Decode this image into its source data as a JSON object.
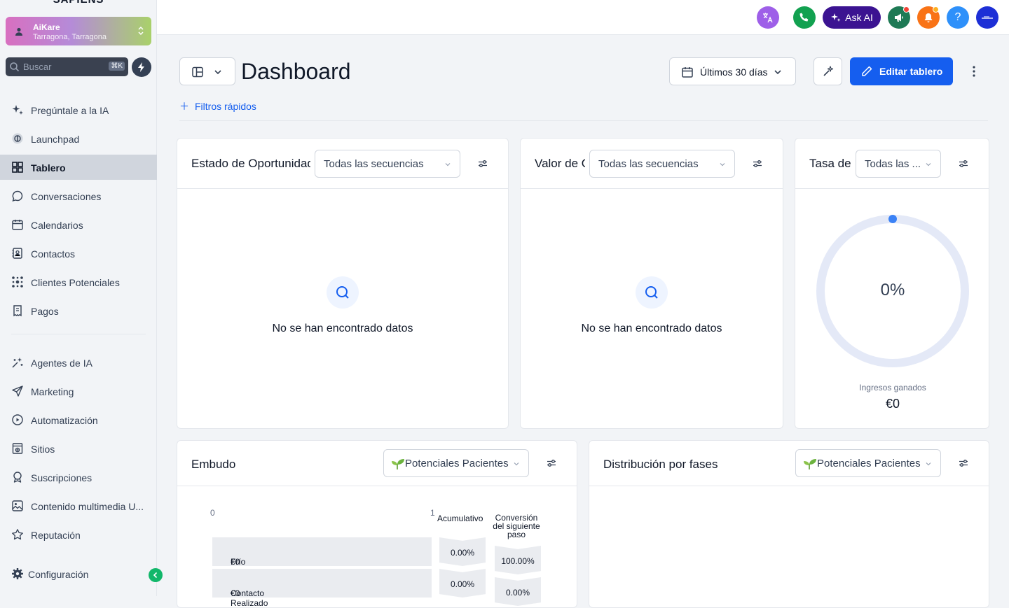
{
  "brand": "SAPIENS",
  "location": {
    "name": "AiKare",
    "address": "Tarragona, Tarragona"
  },
  "search": {
    "placeholder": "Buscar",
    "shortcut": "⌘K"
  },
  "nav": [
    {
      "label": "Pregúntale a la IA",
      "icon": "sparkles-icon"
    },
    {
      "label": "Launchpad",
      "icon": "launchpad-icon"
    },
    {
      "label": "Tablero",
      "icon": "dashboard-icon",
      "active": true
    },
    {
      "label": "Conversaciones",
      "icon": "chat-icon"
    },
    {
      "label": "Calendarios",
      "icon": "calendar-icon"
    },
    {
      "label": "Contactos",
      "icon": "contacts-icon"
    },
    {
      "label": "Clientes Potenciales",
      "icon": "opportunities-icon"
    },
    {
      "label": "Pagos",
      "icon": "payments-icon"
    },
    {
      "label": "Agentes de IA",
      "icon": "ai-agents-icon"
    },
    {
      "label": "Marketing",
      "icon": "send-icon"
    },
    {
      "label": "Automatización",
      "icon": "automation-icon"
    },
    {
      "label": "Sitios",
      "icon": "sites-icon"
    },
    {
      "label": "Suscripciones",
      "icon": "subscriptions-icon"
    },
    {
      "label": "Contenido multimedia U...",
      "icon": "media-icon"
    },
    {
      "label": "Reputación",
      "icon": "star-icon"
    }
  ],
  "settings_label": "Configuración",
  "topbar": {
    "ask_ai": "Ask AI",
    "help": "?"
  },
  "header": {
    "title": "Dashboard",
    "date_range": "Últimos 30 días",
    "edit_button": "Editar tablero",
    "quick_filters": "Filtros rápidos"
  },
  "widgets": {
    "opportunity_status": {
      "title": "Estado de Oportunidades",
      "filter": "Todas las secuencias",
      "empty": "No se han encontrado datos"
    },
    "opportunity_value": {
      "title": "Valor de Oportunidades",
      "filter": "Todas las secuencias",
      "empty": "No se han encontrado datos"
    },
    "conversion_rate": {
      "title": "Tasa de conversión",
      "filter": "Todas las ...",
      "percent": "0%",
      "revenue_label": "Ingresos ganados",
      "revenue_value": "€0",
      "progress": 0
    },
    "funnel": {
      "title": "Embudo",
      "filter": "Potenciales Pacientes",
      "axis_min": "0",
      "axis_max": "1",
      "col_cumulative": "Acumulativo",
      "col_conversion": "Conversión del siguiente paso",
      "rows": [
        {
          "stage": "Frío",
          "value": "€0",
          "cumulative": "0.00%",
          "conversion": "100.00%"
        },
        {
          "stage": "Contacto Realizado",
          "value": "€0",
          "cumulative": "0.00%",
          "conversion": "0.00%"
        }
      ]
    },
    "stage_distribution": {
      "title": "Distribución por fases",
      "filter": "Potenciales Pacientes"
    }
  }
}
